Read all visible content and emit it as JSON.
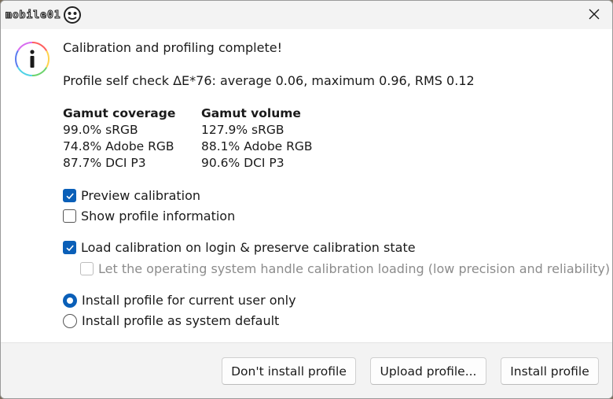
{
  "titlebar": {
    "logo_text": "mobile01",
    "close_icon": "close-icon"
  },
  "message": {
    "icon": "info-icon",
    "title": "Calibration and profiling complete!",
    "self_check": "Profile self check ΔE*76: average 0.06, maximum 0.96, RMS 0.12"
  },
  "gamut": {
    "coverage": {
      "heading": "Gamut coverage",
      "rows": [
        "99.0% sRGB",
        "74.8% Adobe RGB",
        "87.7% DCI P3"
      ]
    },
    "volume": {
      "heading": "Gamut volume",
      "rows": [
        "127.9% sRGB",
        "88.1% Adobe RGB",
        "90.6% DCI P3"
      ]
    }
  },
  "options": {
    "preview_calibration": {
      "label": "Preview calibration",
      "checked": true
    },
    "show_profile_info": {
      "label": "Show profile information",
      "checked": false
    },
    "load_calibration": {
      "label": "Load calibration on login & preserve calibration state",
      "checked": true
    },
    "os_loading": {
      "label": "Let the operating system handle calibration loading (low precision and reliability)",
      "checked": false,
      "disabled": true
    }
  },
  "install_scope": {
    "current_user": {
      "label": "Install profile for current user only",
      "selected": true
    },
    "system_default": {
      "label": "Install profile as system default",
      "selected": false
    }
  },
  "buttons": {
    "dont_install": "Don't install profile",
    "upload": "Upload profile...",
    "install": "Install profile"
  },
  "colors": {
    "accent": "#0a5fb8",
    "footer_bg": "#f3f3f3"
  }
}
